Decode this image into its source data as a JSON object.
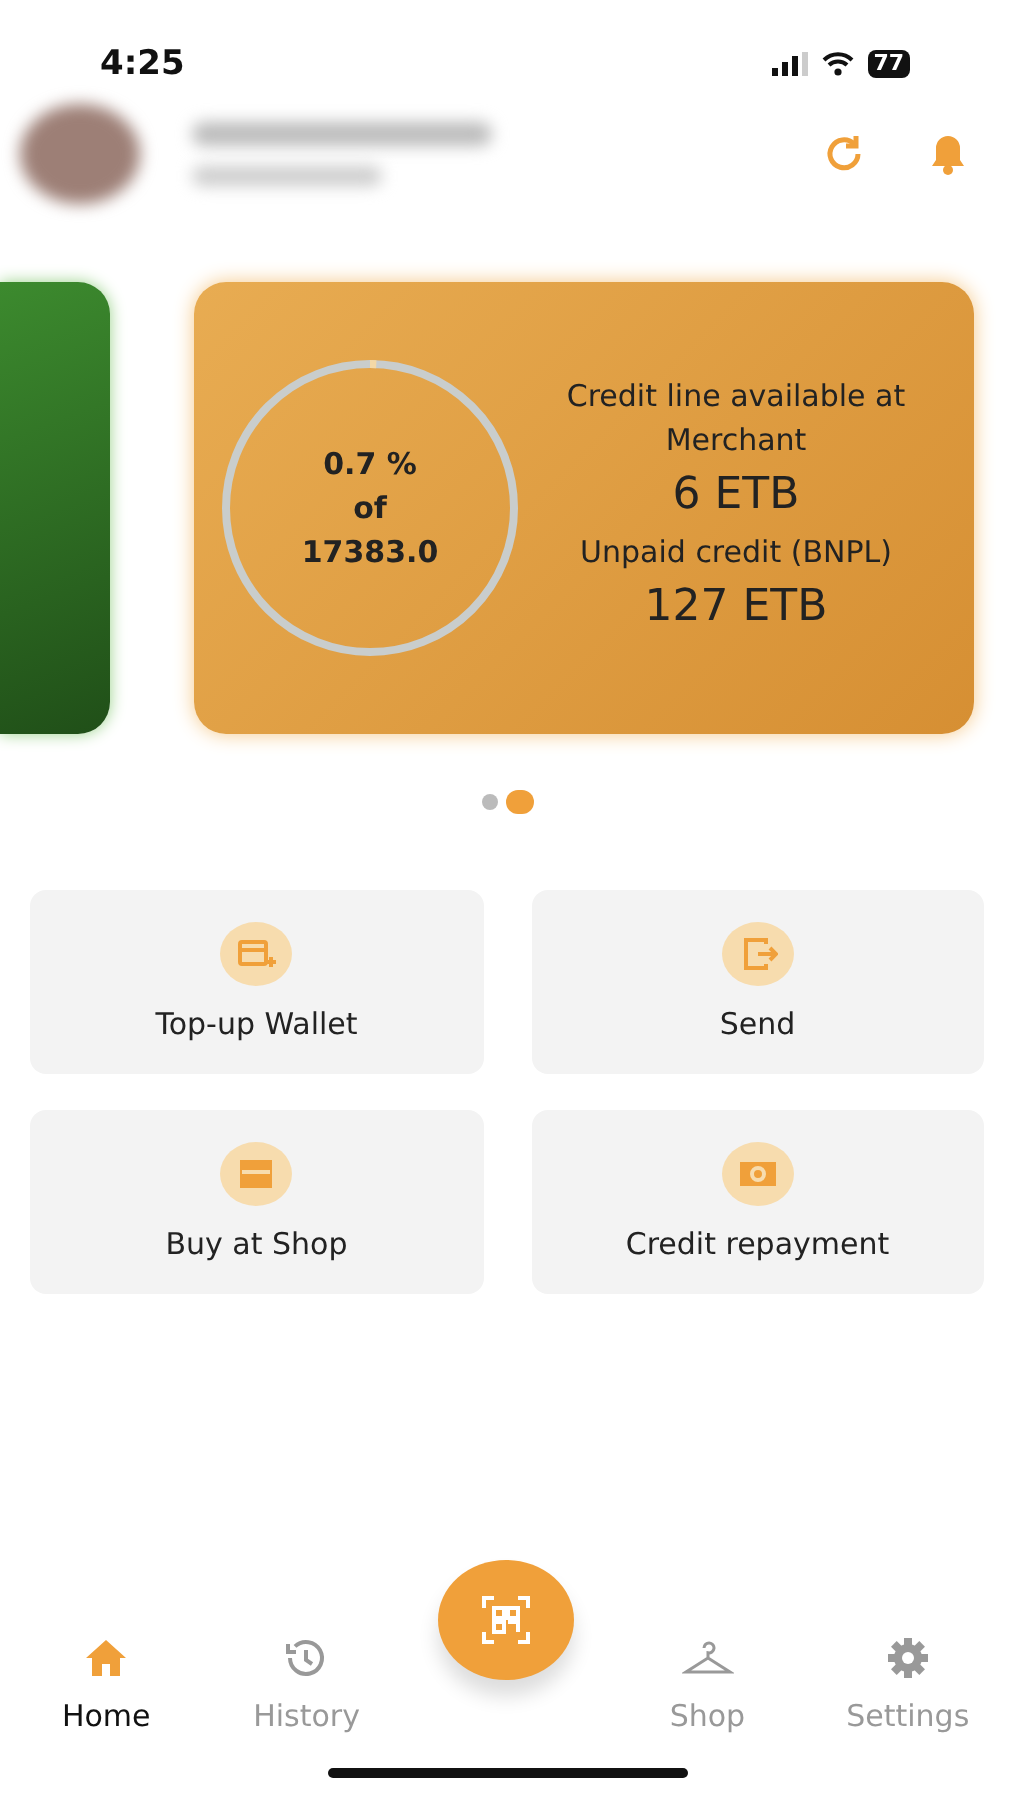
{
  "status_bar": {
    "time": "4:25",
    "battery": "77"
  },
  "carousel": {
    "cards": [
      {
        "kind": "wallet"
      },
      {
        "kind": "credit",
        "gauge": {
          "percent": "0.7 %",
          "of": "of",
          "total": "17383.0",
          "level": 0.007
        },
        "credit_label": "Credit line available at Merchant",
        "credit_value": "6 ETB",
        "unpaid_label": "Unpaid credit (BNPL)",
        "unpaid_value": "127 ETB"
      }
    ],
    "dots": [
      {
        "selected": false
      },
      {
        "selected": true
      }
    ]
  },
  "actions": [
    {
      "label": "Top-up Wallet",
      "kind": "topup"
    },
    {
      "label": "Send",
      "kind": "send"
    },
    {
      "label": "Buy at Shop",
      "kind": "shop"
    },
    {
      "label": "Credit repayment",
      "kind": "repay"
    }
  ],
  "bottom_nav": [
    {
      "label": "Home",
      "kind": "home",
      "selected": true
    },
    {
      "label": "History",
      "kind": "history",
      "selected": false
    },
    {
      "kind": "scan"
    },
    {
      "label": "Shop",
      "kind": "shop",
      "selected": false
    },
    {
      "label": "Settings",
      "kind": "settings",
      "selected": false
    }
  ]
}
